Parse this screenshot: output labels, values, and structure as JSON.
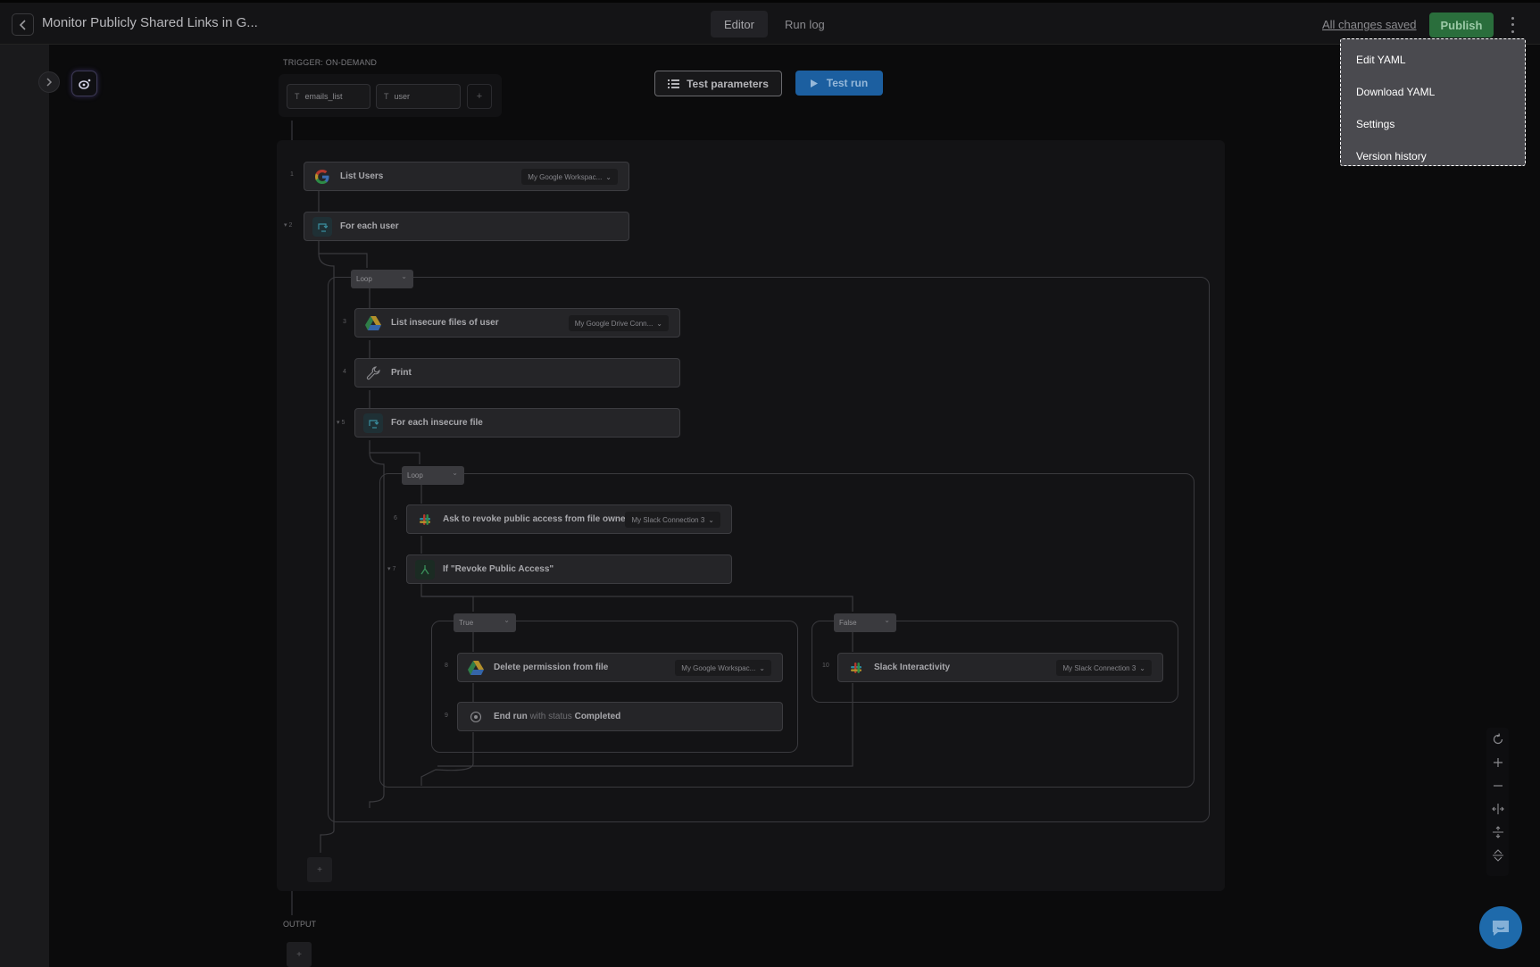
{
  "header": {
    "title": "Monitor Publicly Shared Links in G...",
    "tabs": [
      {
        "label": "Editor",
        "active": true
      },
      {
        "label": "Run log",
        "active": false
      }
    ],
    "saved_status": "All changes saved",
    "publish_label": "Publish"
  },
  "menu": {
    "items": [
      "Edit YAML",
      "Download YAML",
      "Settings",
      "Version history"
    ]
  },
  "trigger": {
    "label": "TRIGGER: ON-DEMAND",
    "params": [
      "emails_list",
      "user"
    ],
    "add_label": "+"
  },
  "toolbar": {
    "test_parameters_label": "Test parameters",
    "test_run_label": "Test run"
  },
  "steps": [
    {
      "num": "1",
      "label": "List Users",
      "connection": "My Google Workspac...",
      "icon": "google-icon"
    },
    {
      "num": "▾ 2",
      "label": "For each user",
      "icon": "loop-icon"
    },
    {
      "num": "3",
      "label": "List insecure files of user",
      "connection": "My Google Drive Conn...",
      "icon": "google-drive-icon"
    },
    {
      "num": "4",
      "label": "Print",
      "icon": "wrench-icon"
    },
    {
      "num": "▾ 5",
      "label": "For each insecure file",
      "icon": "loop-icon"
    },
    {
      "num": "6",
      "label": "Ask to revoke public access from file owner",
      "connection": "My Slack Connection 3",
      "icon": "slack-icon"
    },
    {
      "num": "▾ 7",
      "label": "If \"Revoke Public Access\"",
      "icon": "branch-icon"
    },
    {
      "num": "8",
      "label": "Delete permission from file",
      "connection": "My Google Workspac...",
      "icon": "google-drive-icon"
    },
    {
      "num": "9",
      "label": "End run",
      "muted": "with status",
      "status": "Completed",
      "icon": "stop-icon"
    },
    {
      "num": "10",
      "label": "Slack Interactivity",
      "connection": "My Slack Connection 3",
      "icon": "slack-icon"
    }
  ],
  "pills": {
    "loop1": "Loop",
    "loop2": "Loop",
    "true_branch": "True",
    "false_branch": "False"
  },
  "output_label": "OUTPUT",
  "colors": {
    "publish": "#2a6e3c",
    "test_run": "#1c5fa0",
    "menu_bg": "#4a4a4f"
  }
}
